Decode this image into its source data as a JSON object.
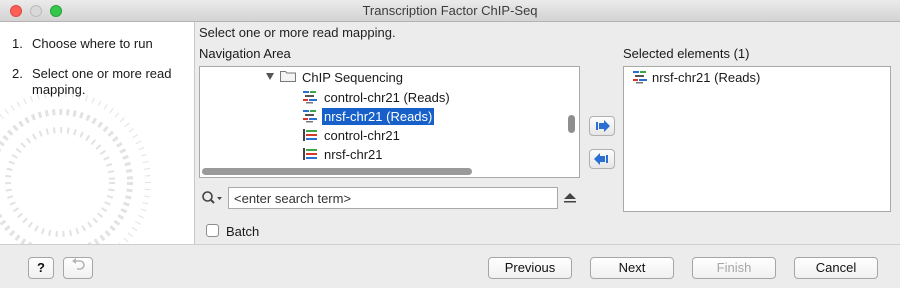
{
  "window": {
    "title": "Transcription Factor ChIP-Seq"
  },
  "steps": [
    {
      "num": "1.",
      "label": "Choose where to run"
    },
    {
      "num": "2.",
      "label": "Select one or more read mapping."
    }
  ],
  "main": {
    "description": "Select one or more read mapping.",
    "navigation_label": "Navigation Area",
    "tree": {
      "folder": "ChIP Sequencing",
      "items": [
        {
          "label": "control-chr21 (Reads)",
          "icon": "reads-mapping-icon",
          "selected": false
        },
        {
          "label": "nrsf-chr21 (Reads)",
          "icon": "reads-mapping-icon",
          "selected": true
        },
        {
          "label": "control-chr21",
          "icon": "sequence-track-icon",
          "selected": false
        },
        {
          "label": "nrsf-chr21",
          "icon": "sequence-track-icon",
          "selected": false
        }
      ]
    },
    "search": {
      "placeholder": "<enter search term>"
    },
    "batch_label": "Batch",
    "selected_label": "Selected elements (1)",
    "selected_items": [
      {
        "label": "nrsf-chr21 (Reads)",
        "icon": "reads-mapping-icon"
      }
    ]
  },
  "footer": {
    "help": "?",
    "previous": "Previous",
    "next": "Next",
    "finish": "Finish",
    "cancel": "Cancel"
  },
  "colors": {
    "selection": "#1760c9",
    "arrow": "#2a6fd1"
  }
}
